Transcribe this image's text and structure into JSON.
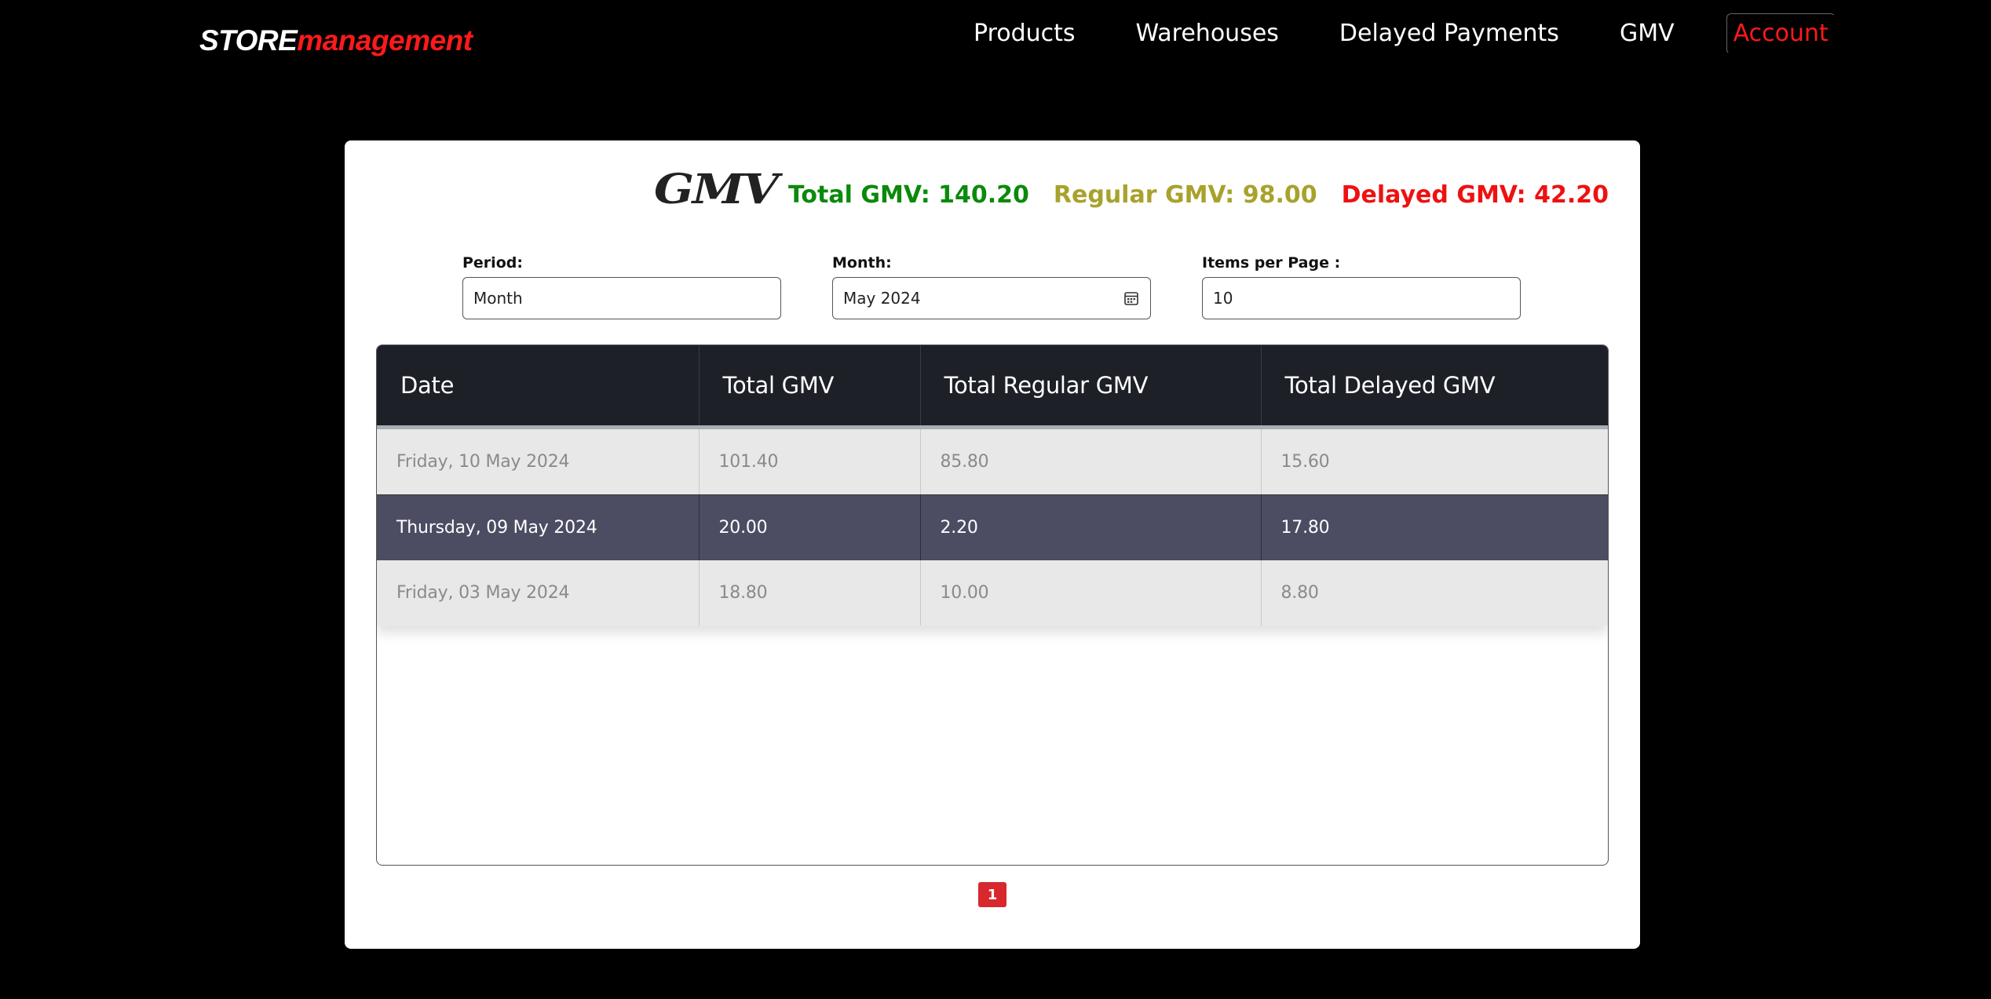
{
  "brand": {
    "part1": "STORE",
    "part2": "management"
  },
  "nav": {
    "items": [
      {
        "label": "Products"
      },
      {
        "label": "Warehouses"
      },
      {
        "label": "Delayed Payments"
      },
      {
        "label": "GMV"
      }
    ],
    "account": "Account"
  },
  "page": {
    "title": "GMV",
    "totals": {
      "total": "Total GMV: 140.20",
      "regular": "Regular GMV: 98.00",
      "delayed": "Delayed GMV: 42.20"
    }
  },
  "filters": {
    "period": {
      "label": "Period:",
      "value": "Month"
    },
    "month": {
      "label": "Month:",
      "value": "May 2024"
    },
    "items_per_page": {
      "label": "Items per Page :",
      "value": "10"
    }
  },
  "table": {
    "headers": [
      "Date",
      "Total GMV",
      "Total Regular GMV",
      "Total Delayed GMV"
    ],
    "rows": [
      [
        "Friday, 10 May 2024",
        "101.40",
        "85.80",
        "15.60"
      ],
      [
        "Thursday, 09 May 2024",
        "20.00",
        "2.20",
        "17.80"
      ],
      [
        "Friday, 03 May 2024",
        "18.80",
        "10.00",
        "8.80"
      ]
    ]
  },
  "pagination": {
    "current": "1"
  },
  "colors": {
    "brand_accent": "#ff1a1a",
    "total_gmv": "#0b8a0b",
    "regular_gmv": "#a8a22c",
    "delayed_gmv": "#ee1111",
    "selected_row": "#4c4d63",
    "pager": "#d7282e"
  },
  "icons": {
    "month_picker": "calendar-icon"
  }
}
